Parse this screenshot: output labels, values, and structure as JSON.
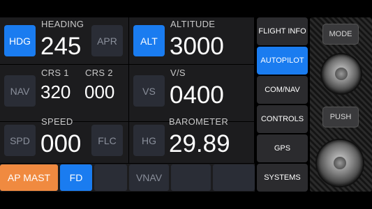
{
  "heading": {
    "mode": "HDG",
    "label": "HEADING",
    "value": "245",
    "alt_mode": "APR"
  },
  "altitude": {
    "mode": "ALT",
    "label": "ALTITUDE",
    "value": "3000"
  },
  "nav": {
    "mode": "NAV",
    "crs1_label": "CRS 1",
    "crs1_value": "320",
    "crs2_label": "CRS 2",
    "crs2_value": "000"
  },
  "vs": {
    "mode": "VS",
    "label": "V/S",
    "value": "0400"
  },
  "speed": {
    "mode": "SPD",
    "label": "SPEED",
    "value": "000",
    "alt_mode": "FLC"
  },
  "barometer": {
    "mode": "HG",
    "label": "BAROMETER",
    "value": "29.89"
  },
  "bottom": {
    "ap_master": "AP MAST",
    "fd": "FD",
    "vnav": "VNAV"
  },
  "menu": {
    "items": [
      "FLIGHT INFO",
      "AUTOPILOT",
      "COM/NAV",
      "CONTROLS",
      "GPS",
      "SYSTEMS"
    ]
  },
  "hardware": {
    "mode": "MODE",
    "push": "PUSH"
  },
  "colors": {
    "active_blue": "#1a7cf0",
    "ap_orange": "#f08a40",
    "panel": "#1c1c1e"
  }
}
